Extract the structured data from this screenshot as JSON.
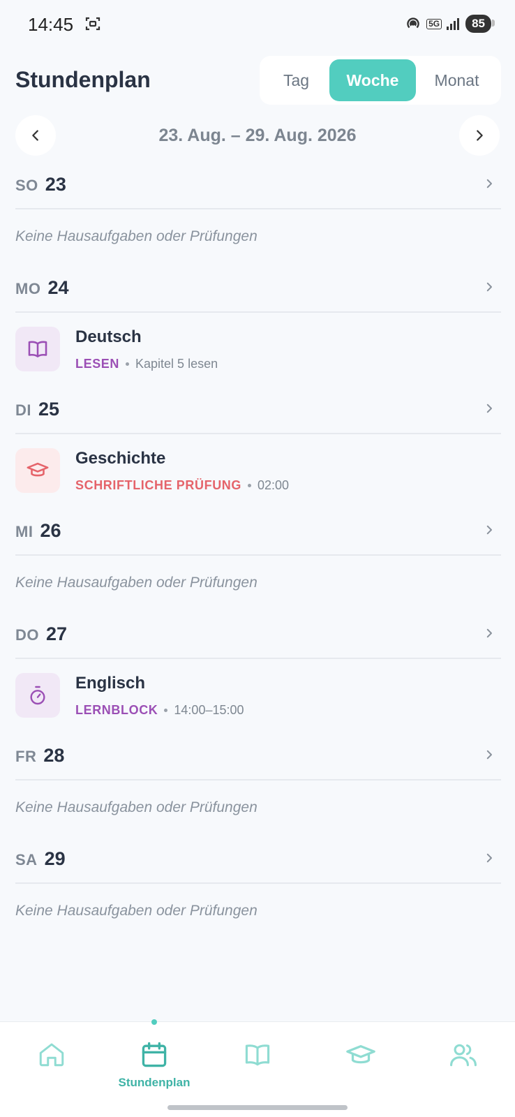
{
  "status_bar": {
    "time": "14:45",
    "battery": "85",
    "network": "5G"
  },
  "header": {
    "title": "Stundenplan"
  },
  "view_toggle": {
    "options": [
      "Tag",
      "Woche",
      "Monat"
    ],
    "selected": "Woche"
  },
  "week": {
    "range": "23. Aug. – 29. Aug. 2026"
  },
  "days": [
    {
      "abbr": "SO",
      "num": "23",
      "empty_text": "Keine Hausaufgaben oder Prüfungen"
    },
    {
      "abbr": "MO",
      "num": "24",
      "entry": {
        "subject": "Deutsch",
        "type": "LESEN",
        "detail": "Kapitel 5 lesen",
        "icon": "book-icon"
      }
    },
    {
      "abbr": "DI",
      "num": "25",
      "entry": {
        "subject": "Geschichte",
        "type": "SCHRIFTLICHE PRÜFUNG",
        "detail": "02:00",
        "icon": "graduation-cap-icon"
      }
    },
    {
      "abbr": "MI",
      "num": "26",
      "empty_text": "Keine Hausaufgaben oder Prüfungen"
    },
    {
      "abbr": "DO",
      "num": "27",
      "entry": {
        "subject": "Englisch",
        "type": "LERNBLOCK",
        "detail": "14:00–15:00",
        "icon": "stopwatch-icon"
      }
    },
    {
      "abbr": "FR",
      "num": "28",
      "empty_text": "Keine Hausaufgaben oder Prüfungen"
    },
    {
      "abbr": "SA",
      "num": "29",
      "empty_text": "Keine Hausaufgaben oder Prüfungen"
    }
  ],
  "bottom_nav": {
    "items": [
      {
        "icon": "home-icon"
      },
      {
        "icon": "calendar-icon",
        "label": "Stundenplan",
        "active": true
      },
      {
        "icon": "book-icon"
      },
      {
        "icon": "graduation-cap-icon"
      },
      {
        "icon": "users-icon"
      }
    ]
  },
  "colors": {
    "accent": "#52cdbf",
    "reading": "#9b4fb5",
    "exam": "#e5636a",
    "reading_bg": "#f1e8f6",
    "exam_bg": "#fcebec"
  }
}
